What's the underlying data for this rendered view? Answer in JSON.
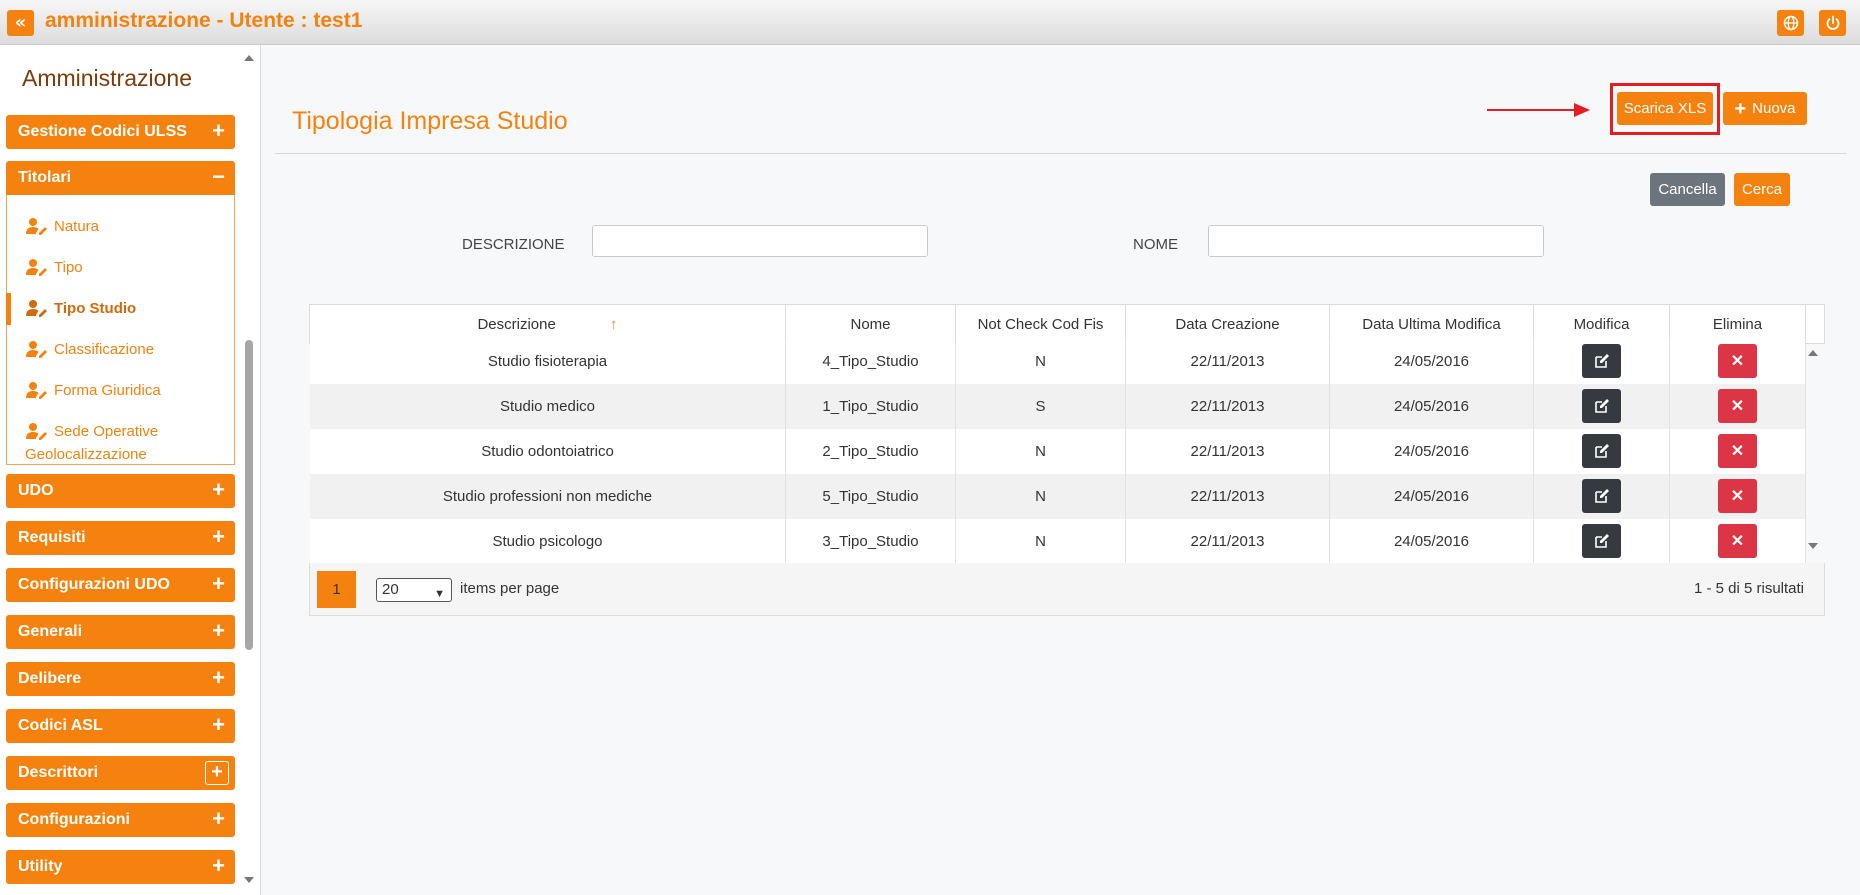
{
  "header": {
    "title": "amministrazione - Utente : test1"
  },
  "sidebar": {
    "title": "Amministrazione",
    "sections": [
      {
        "label": "Gestione Codici ULSS",
        "toggle": "+"
      },
      {
        "label": "Titolari",
        "toggle": "−"
      },
      {
        "label": "UDO",
        "toggle": "+"
      },
      {
        "label": "Requisiti",
        "toggle": "+"
      },
      {
        "label": "Configurazioni UDO",
        "toggle": "+"
      },
      {
        "label": "Generali",
        "toggle": "+"
      },
      {
        "label": "Delibere",
        "toggle": "+"
      },
      {
        "label": "Codici ASL",
        "toggle": "+"
      },
      {
        "label": "Descrittori",
        "toggle": "+"
      },
      {
        "label": "Configurazioni",
        "toggle": "+"
      },
      {
        "label": "Utility",
        "toggle": "+"
      }
    ],
    "titolari_items": [
      {
        "label": "Natura"
      },
      {
        "label": "Tipo"
      },
      {
        "label": "Tipo Studio"
      },
      {
        "label": "Classificazione"
      },
      {
        "label": "Forma Giuridica"
      },
      {
        "label": "Sede Operative",
        "label2": "Geolocalizzazione"
      }
    ]
  },
  "page": {
    "title": "Tipologia Impresa Studio",
    "buttons": {
      "scarica": "Scarica XLS",
      "nuova": "Nuova",
      "cancella": "Cancella",
      "cerca": "Cerca"
    },
    "filters": {
      "descrizione_label": "DESCRIZIONE",
      "descrizione_value": "",
      "nome_label": "NOME",
      "nome_value": ""
    }
  },
  "table": {
    "columns": [
      "Descrizione",
      "Nome",
      "Not Check Cod Fis",
      "Data Creazione",
      "Data Ultima Modifica",
      "Modifica",
      "Elimina"
    ],
    "sort_icon": "↑",
    "rows": [
      [
        "Studio fisioterapia",
        "4_Tipo_Studio",
        "N",
        "22/11/2013",
        "24/05/2016"
      ],
      [
        "Studio medico",
        "1_Tipo_Studio",
        "S",
        "22/11/2013",
        "24/05/2016"
      ],
      [
        "Studio odontoiatrico",
        "2_Tipo_Studio",
        "N",
        "22/11/2013",
        "24/05/2016"
      ],
      [
        "Studio professioni non mediche",
        "5_Tipo_Studio",
        "N",
        "22/11/2013",
        "24/05/2016"
      ],
      [
        "Studio psicologo",
        "3_Tipo_Studio",
        "N",
        "22/11/2013",
        "24/05/2016"
      ]
    ],
    "delete_glyph": "✕"
  },
  "pager": {
    "current_page": "1",
    "per_page": "20",
    "per_page_label": "items per page",
    "results": "1 - 5 di 5 risultati"
  },
  "colors": {
    "accent": "#f5820e",
    "danger": "#dc3545",
    "dark": "#343a40",
    "highlight": "#e51c23"
  }
}
